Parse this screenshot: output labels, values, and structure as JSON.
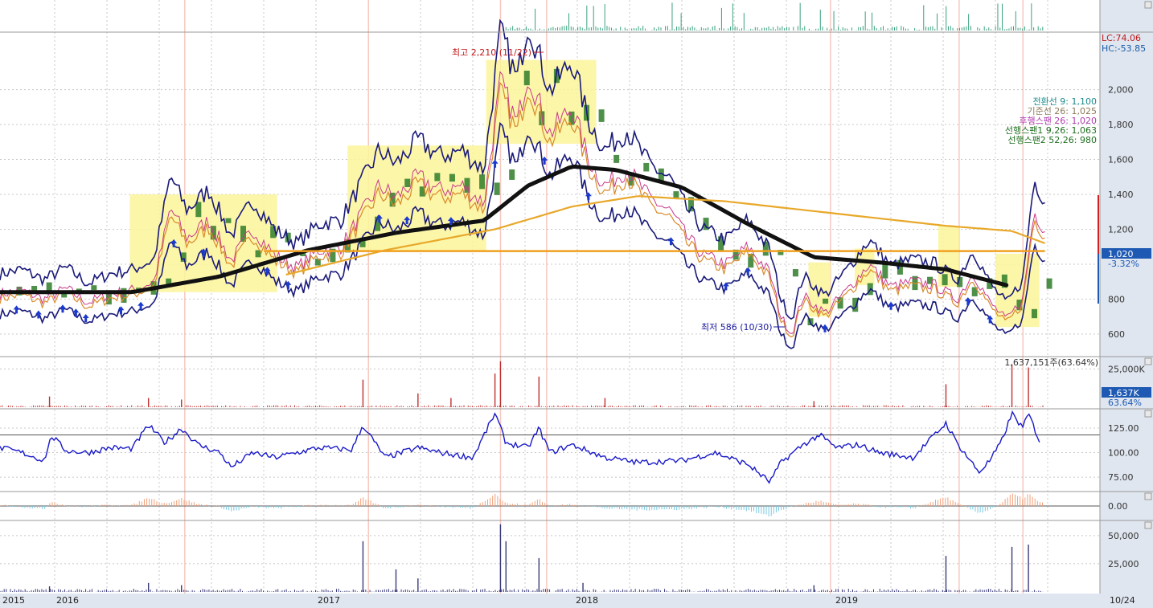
{
  "chart_data": {
    "type": "line",
    "x_axis": {
      "year_labels": [
        "2015",
        "2016",
        "2017",
        "2018",
        "2019"
      ],
      "date_label": "10/24"
    },
    "price_panel": {
      "ylim": [
        480,
        2320
      ],
      "y_ticks": [
        {
          "value": 600,
          "label": "600"
        },
        {
          "value": 800,
          "label": "800"
        },
        {
          "value": 1000,
          "label": ""
        },
        {
          "value": 1200,
          "label": "1,200"
        },
        {
          "value": 1400,
          "label": "1,400"
        },
        {
          "value": 1600,
          "label": "1,600"
        },
        {
          "value": 1800,
          "label": "1,800"
        },
        {
          "value": 2000,
          "label": "2,000"
        }
      ],
      "top_right": {
        "lc": "LC:74.06",
        "hc": "HC:-53.85"
      },
      "current_price": "1,020",
      "current_change": "-3.32%",
      "high_annotation": "최고 2,210 (11/22)",
      "low_annotation": "최저 586 (10/30)",
      "legend": [
        {
          "text": "전환선 9: 1,100",
          "color": "#1a8a8a"
        },
        {
          "text": "기준선 26: 1,025",
          "color": "#8a7a5a"
        },
        {
          "text": "후행스팬 26: 1,020",
          "color": "#b03cb0"
        },
        {
          "text": "선행스팬1 9,26: 1,063",
          "color": "#1e6e1e"
        },
        {
          "text": "선행스팬2 52,26: 980",
          "color": "#1e6e1e"
        }
      ],
      "price_anchors": [
        [
          0,
          830
        ],
        [
          0.02,
          850
        ],
        [
          0.04,
          800
        ],
        [
          0.06,
          860
        ],
        [
          0.08,
          780
        ],
        [
          0.1,
          830
        ],
        [
          0.12,
          850
        ],
        [
          0.14,
          900
        ],
        [
          0.155,
          1320
        ],
        [
          0.17,
          1150
        ],
        [
          0.19,
          1250
        ],
        [
          0.21,
          1020
        ],
        [
          0.23,
          1200
        ],
        [
          0.25,
          1050
        ],
        [
          0.27,
          980
        ],
        [
          0.29,
          1080
        ],
        [
          0.31,
          1100
        ],
        [
          0.33,
          1300
        ],
        [
          0.345,
          1450
        ],
        [
          0.36,
          1380
        ],
        [
          0.38,
          1500
        ],
        [
          0.4,
          1420
        ],
        [
          0.42,
          1450
        ],
        [
          0.44,
          1350
        ],
        [
          0.455,
          2050
        ],
        [
          0.47,
          1800
        ],
        [
          0.48,
          2100
        ],
        [
          0.5,
          1750
        ],
        [
          0.52,
          1900
        ],
        [
          0.535,
          1600
        ],
        [
          0.55,
          1450
        ],
        [
          0.57,
          1550
        ],
        [
          0.59,
          1380
        ],
        [
          0.61,
          1300
        ],
        [
          0.625,
          1150
        ],
        [
          0.64,
          1050
        ],
        [
          0.66,
          1000
        ],
        [
          0.68,
          1100
        ],
        [
          0.7,
          950
        ],
        [
          0.71,
          700
        ],
        [
          0.72,
          600
        ],
        [
          0.73,
          820
        ],
        [
          0.75,
          720
        ],
        [
          0.77,
          850
        ],
        [
          0.79,
          1000
        ],
        [
          0.81,
          870
        ],
        [
          0.83,
          900
        ],
        [
          0.85,
          880
        ],
        [
          0.87,
          800
        ],
        [
          0.885,
          950
        ],
        [
          0.9,
          780
        ],
        [
          0.915,
          680
        ],
        [
          0.93,
          800
        ],
        [
          0.94,
          1300
        ],
        [
          0.95,
          1200
        ]
      ],
      "ma_long_anchors": [
        [
          0,
          840
        ],
        [
          0.12,
          840
        ],
        [
          0.2,
          930
        ],
        [
          0.28,
          1080
        ],
        [
          0.36,
          1180
        ],
        [
          0.44,
          1250
        ],
        [
          0.48,
          1450
        ],
        [
          0.52,
          1560
        ],
        [
          0.56,
          1540
        ],
        [
          0.62,
          1440
        ],
        [
          0.68,
          1230
        ],
        [
          0.74,
          1040
        ],
        [
          0.8,
          1010
        ],
        [
          0.86,
          970
        ],
        [
          0.915,
          880
        ]
      ],
      "ma_orange_anchors": [
        [
          0.26,
          940
        ],
        [
          0.35,
          1080
        ],
        [
          0.45,
          1200
        ],
        [
          0.52,
          1330
        ],
        [
          0.58,
          1390
        ],
        [
          0.66,
          1360
        ],
        [
          0.76,
          1290
        ],
        [
          0.86,
          1220
        ],
        [
          0.92,
          1190
        ],
        [
          0.95,
          1120
        ]
      ],
      "flat_line_value": 1075,
      "flat_line_range": [
        0.24,
        0.95
      ],
      "highlight_boxes": [
        {
          "x0": 0.118,
          "x1": 0.252,
          "y0": 840,
          "y1": 1400
        },
        {
          "x0": 0.316,
          "x1": 0.442,
          "y0": 1080,
          "y1": 1680
        },
        {
          "x0": 0.442,
          "x1": 0.542,
          "y0": 1690,
          "y1": 2170
        },
        {
          "x0": 0.735,
          "x1": 0.755,
          "y0": 700,
          "y1": 1010
        },
        {
          "x0": 0.777,
          "x1": 0.795,
          "y0": 880,
          "y1": 1090
        },
        {
          "x0": 0.853,
          "x1": 0.872,
          "y0": 870,
          "y1": 1220
        },
        {
          "x0": 0.905,
          "x1": 0.945,
          "y0": 640,
          "y1": 1060
        }
      ]
    },
    "volume_panel": {
      "title": "1,637,151주(63.64%)",
      "ylim": [
        0,
        32000
      ],
      "y_ticks": [
        {
          "value": 25000,
          "label": "25,000K"
        }
      ],
      "current_value": "1,637K",
      "current_pct": "63.64%",
      "spikes": [
        [
          0.045,
          7000
        ],
        [
          0.135,
          6000
        ],
        [
          0.165,
          5000
        ],
        [
          0.33,
          18000
        ],
        [
          0.38,
          9000
        ],
        [
          0.41,
          6000
        ],
        [
          0.45,
          22000
        ],
        [
          0.455,
          30000
        ],
        [
          0.49,
          20000
        ],
        [
          0.55,
          6000
        ],
        [
          0.74,
          4000
        ],
        [
          0.86,
          15000
        ],
        [
          0.92,
          28000
        ],
        [
          0.935,
          26000
        ]
      ]
    },
    "indicator_panel": {
      "ylim": [
        62,
        143
      ],
      "y_ticks": [
        {
          "value": 75,
          "label": "75.00"
        },
        {
          "value": 100,
          "label": "100.00"
        },
        {
          "value": 125,
          "label": "125.00"
        }
      ],
      "reference_line": 118,
      "anchors": [
        [
          0,
          105
        ],
        [
          0.02,
          100
        ],
        [
          0.04,
          92
        ],
        [
          0.047,
          117
        ],
        [
          0.06,
          102
        ],
        [
          0.08,
          100
        ],
        [
          0.1,
          105
        ],
        [
          0.12,
          104
        ],
        [
          0.135,
          128
        ],
        [
          0.15,
          110
        ],
        [
          0.165,
          125
        ],
        [
          0.18,
          108
        ],
        [
          0.2,
          100
        ],
        [
          0.21,
          85
        ],
        [
          0.23,
          100
        ],
        [
          0.25,
          95
        ],
        [
          0.27,
          100
        ],
        [
          0.29,
          105
        ],
        [
          0.32,
          103
        ],
        [
          0.33,
          128
        ],
        [
          0.35,
          95
        ],
        [
          0.38,
          105
        ],
        [
          0.4,
          100
        ],
        [
          0.43,
          95
        ],
        [
          0.45,
          140
        ],
        [
          0.46,
          110
        ],
        [
          0.48,
          105
        ],
        [
          0.49,
          125
        ],
        [
          0.5,
          100
        ],
        [
          0.52,
          108
        ],
        [
          0.55,
          95
        ],
        [
          0.58,
          90
        ],
        [
          0.62,
          92
        ],
        [
          0.65,
          100
        ],
        [
          0.68,
          88
        ],
        [
          0.7,
          70
        ],
        [
          0.71,
          90
        ],
        [
          0.73,
          108
        ],
        [
          0.745,
          118
        ],
        [
          0.76,
          105
        ],
        [
          0.78,
          108
        ],
        [
          0.8,
          100
        ],
        [
          0.83,
          95
        ],
        [
          0.86,
          130
        ],
        [
          0.87,
          110
        ],
        [
          0.88,
          95
        ],
        [
          0.89,
          80
        ],
        [
          0.9,
          92
        ],
        [
          0.91,
          110
        ],
        [
          0.92,
          140
        ],
        [
          0.93,
          125
        ],
        [
          0.935,
          140
        ],
        [
          0.945,
          112
        ]
      ]
    },
    "oscillator_panel": {
      "ylim": [
        -10,
        10
      ],
      "y_ticks": [
        {
          "value": 0,
          "label": "0.00"
        }
      ]
    },
    "lower_volume_panel": {
      "ylim": [
        0,
        62000
      ],
      "y_ticks": [
        {
          "value": 25000,
          "label": "25,000"
        },
        {
          "value": 50000,
          "label": "50,000"
        }
      ],
      "spikes": [
        [
          0.045,
          5000
        ],
        [
          0.135,
          8000
        ],
        [
          0.165,
          6000
        ],
        [
          0.33,
          45000
        ],
        [
          0.36,
          20000
        ],
        [
          0.38,
          12000
        ],
        [
          0.455,
          60000
        ],
        [
          0.46,
          45000
        ],
        [
          0.49,
          30000
        ],
        [
          0.53,
          8000
        ],
        [
          0.74,
          6000
        ],
        [
          0.86,
          32000
        ],
        [
          0.92,
          40000
        ],
        [
          0.935,
          42000
        ]
      ]
    }
  }
}
